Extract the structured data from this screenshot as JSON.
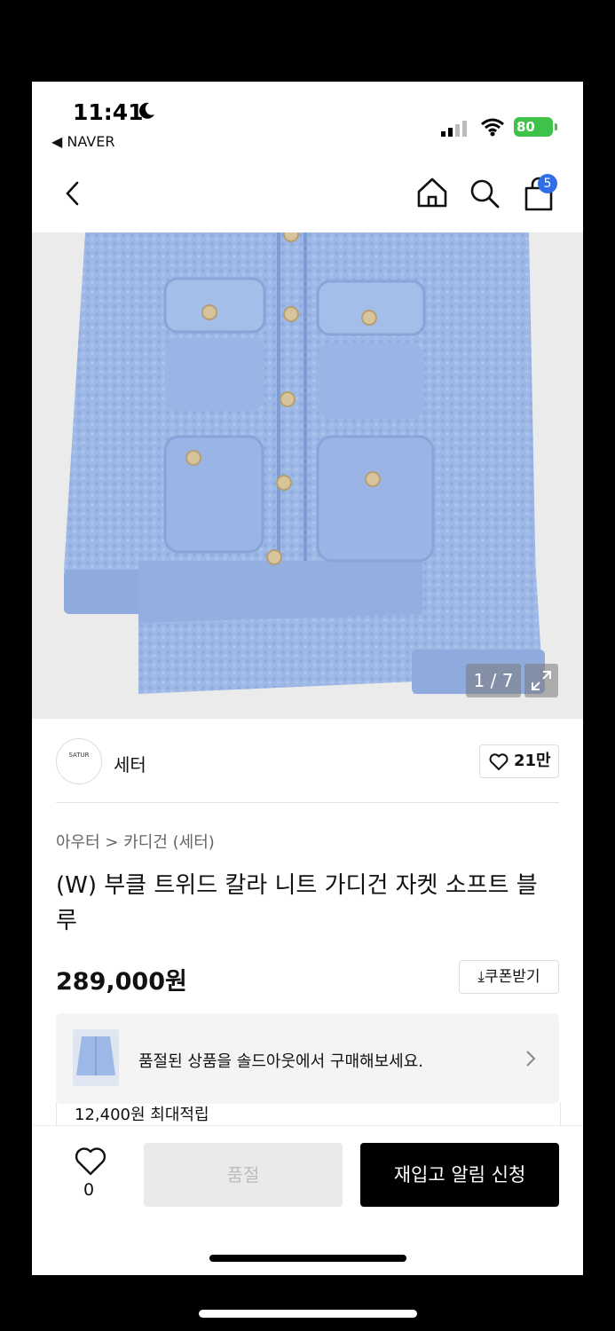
{
  "status_bar": {
    "time": "11:41",
    "back_app": "◀ NAVER",
    "battery": "80"
  },
  "nav": {
    "cart_count": "5"
  },
  "gallery": {
    "counter": "1 / 7"
  },
  "brand": {
    "logo_text": "SATUR",
    "name": "세터",
    "likes": "21만"
  },
  "product": {
    "breadcrumb": "아우터 > 카디건 (세터)",
    "title": "(W) 부클 트위드 칼라 니트 가디건 자켓 소프트 블루",
    "price": "289,000원",
    "coupon_label": "쿠폰받기",
    "soldout_banner": "품절된 상품을 솔드아웃에서 구매해보세요.",
    "points": "12,400원 최대적립"
  },
  "bottom_bar": {
    "wish_count": "0",
    "soldout_label": "품절",
    "restock_label": "재입고 알림 신청"
  },
  "colors": {
    "jacket": "#9db8e6",
    "badge": "#2f6ee8",
    "battery": "#3ec24a"
  }
}
